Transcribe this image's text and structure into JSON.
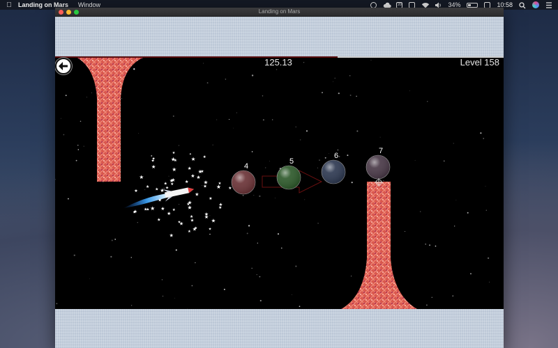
{
  "menubar": {
    "app_name": "Landing on Mars",
    "menus": [
      "Window"
    ],
    "calendar_day": "20",
    "battery_percent": "34%",
    "clock": "10:58"
  },
  "window": {
    "title": "Landing on Mars"
  },
  "game": {
    "timer": "125.13",
    "level": "Level 158",
    "fuel_fraction": 0.63,
    "balls": [
      {
        "label": "4",
        "color": "#6b3438"
      },
      {
        "label": "5",
        "color": "#2f5a2c"
      },
      {
        "label": "6",
        "color": "#2f3a52"
      },
      {
        "label": "7",
        "color": "#4a3a48"
      }
    ],
    "column_color": "#d9584e"
  }
}
